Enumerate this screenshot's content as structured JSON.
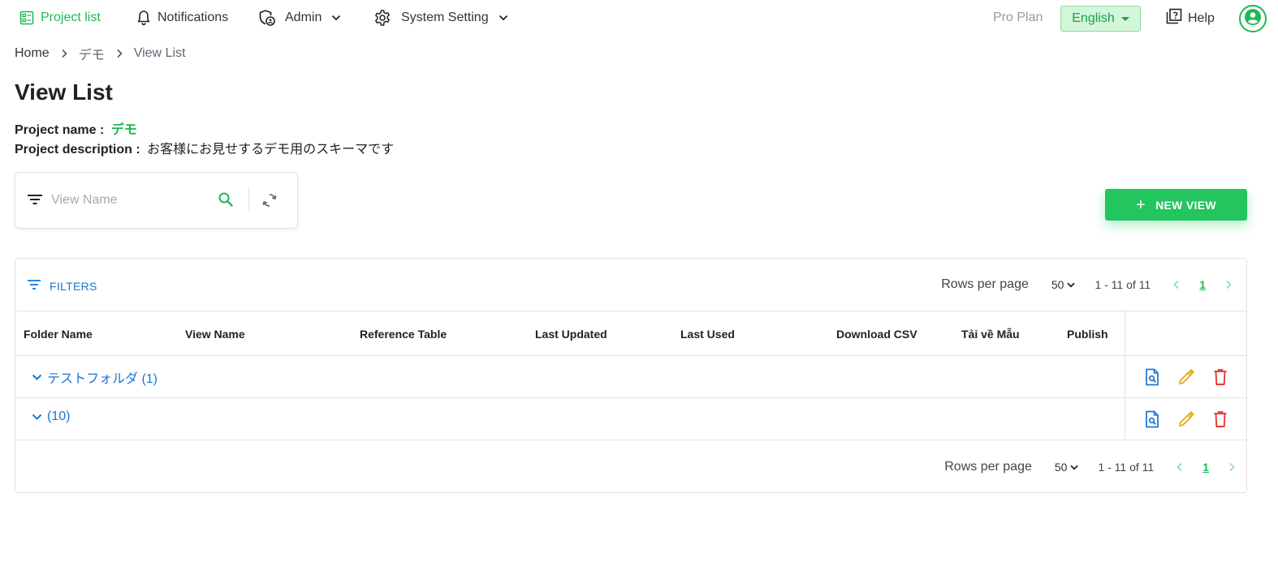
{
  "nav": {
    "project_list": "Project list",
    "notifications": "Notifications",
    "admin": "Admin",
    "system_setting": "System Setting",
    "plan": "Pro Plan",
    "language": "English",
    "help": "Help"
  },
  "breadcrumb": {
    "home": "Home",
    "project": "デモ",
    "current": "View List"
  },
  "page": {
    "title": "View List",
    "project_name_label": "Project name :",
    "project_name": "デモ",
    "project_description_label": "Project description :",
    "project_description": "お客様にお見せするデモ用のスキーマです"
  },
  "search": {
    "placeholder": "View Name",
    "value": ""
  },
  "actions": {
    "new_view": "NEW VIEW",
    "new_view_icon": "+"
  },
  "table": {
    "filters_label": "FILTERS",
    "columns": [
      "Folder Name",
      "View Name",
      "Reference Table",
      "Last Updated",
      "Last Used",
      "Download CSV",
      "Tải về Mẫu",
      "Publish"
    ],
    "rows": [
      {
        "folder": "テストフォルダ (1)"
      },
      {
        "folder": "(10)"
      }
    ],
    "row_actions": [
      "view-icon",
      "edit-icon",
      "delete-icon"
    ]
  },
  "pagination": {
    "rows_per_page_label": "Rows per page",
    "rows_per_page": "50",
    "range": "1 - 11 of 11",
    "current_page": "1"
  },
  "colors": {
    "brand_green": "#22c55e",
    "link_blue": "#1976d2",
    "edit_orange": "#e6a817",
    "delete_red": "#e53935"
  }
}
